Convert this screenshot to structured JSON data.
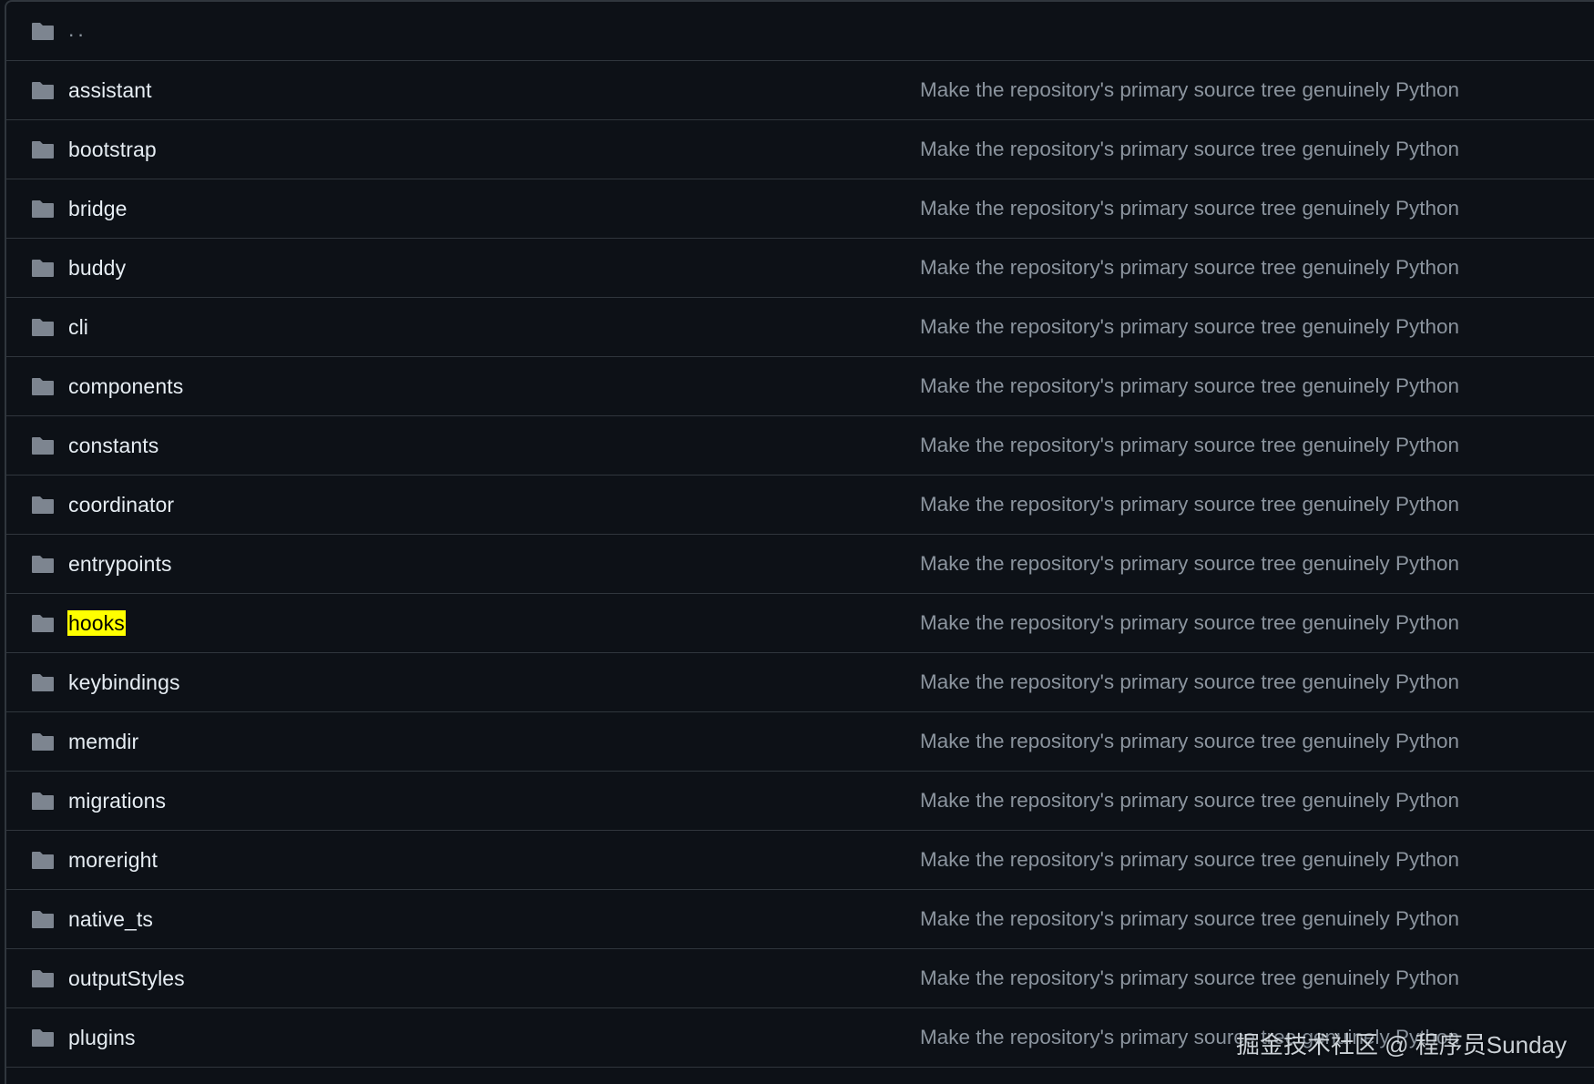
{
  "colors": {
    "background": "#0d1117",
    "border": "#30363d",
    "folder_icon": "#7d8590",
    "name_text": "#e6edf3",
    "commit_text": "#8b949e",
    "highlight": "#ffff00"
  },
  "parent_dir": {
    "label": "..",
    "icon": "folder-icon"
  },
  "rows": [
    {
      "name": "assistant",
      "commit": "Make the repository's primary source tree genuinely Python",
      "icon": "folder-icon"
    },
    {
      "name": "bootstrap",
      "commit": "Make the repository's primary source tree genuinely Python",
      "icon": "folder-icon"
    },
    {
      "name": "bridge",
      "commit": "Make the repository's primary source tree genuinely Python",
      "icon": "folder-icon"
    },
    {
      "name": "buddy",
      "commit": "Make the repository's primary source tree genuinely Python",
      "icon": "folder-icon"
    },
    {
      "name": "cli",
      "commit": "Make the repository's primary source tree genuinely Python",
      "icon": "folder-icon"
    },
    {
      "name": "components",
      "commit": "Make the repository's primary source tree genuinely Python",
      "icon": "folder-icon"
    },
    {
      "name": "constants",
      "commit": "Make the repository's primary source tree genuinely Python",
      "icon": "folder-icon"
    },
    {
      "name": "coordinator",
      "commit": "Make the repository's primary source tree genuinely Python",
      "icon": "folder-icon"
    },
    {
      "name": "entrypoints",
      "commit": "Make the repository's primary source tree genuinely Python",
      "icon": "folder-icon"
    },
    {
      "name": "hooks",
      "commit": "Make the repository's primary source tree genuinely Python",
      "icon": "folder-icon",
      "highlighted": true
    },
    {
      "name": "keybindings",
      "commit": "Make the repository's primary source tree genuinely Python",
      "icon": "folder-icon"
    },
    {
      "name": "memdir",
      "commit": "Make the repository's primary source tree genuinely Python",
      "icon": "folder-icon"
    },
    {
      "name": "migrations",
      "commit": "Make the repository's primary source tree genuinely Python",
      "icon": "folder-icon"
    },
    {
      "name": "moreright",
      "commit": "Make the repository's primary source tree genuinely Python",
      "icon": "folder-icon"
    },
    {
      "name": "native_ts",
      "commit": "Make the repository's primary source tree genuinely Python",
      "icon": "folder-icon"
    },
    {
      "name": "outputStyles",
      "commit": "Make the repository's primary source tree genuinely Python",
      "icon": "folder-icon"
    },
    {
      "name": "plugins",
      "commit": "Make the repository's primary source tree genuinely Python",
      "icon": "folder-icon"
    }
  ],
  "watermark": "掘金技术社区 @ 程序员Sunday"
}
